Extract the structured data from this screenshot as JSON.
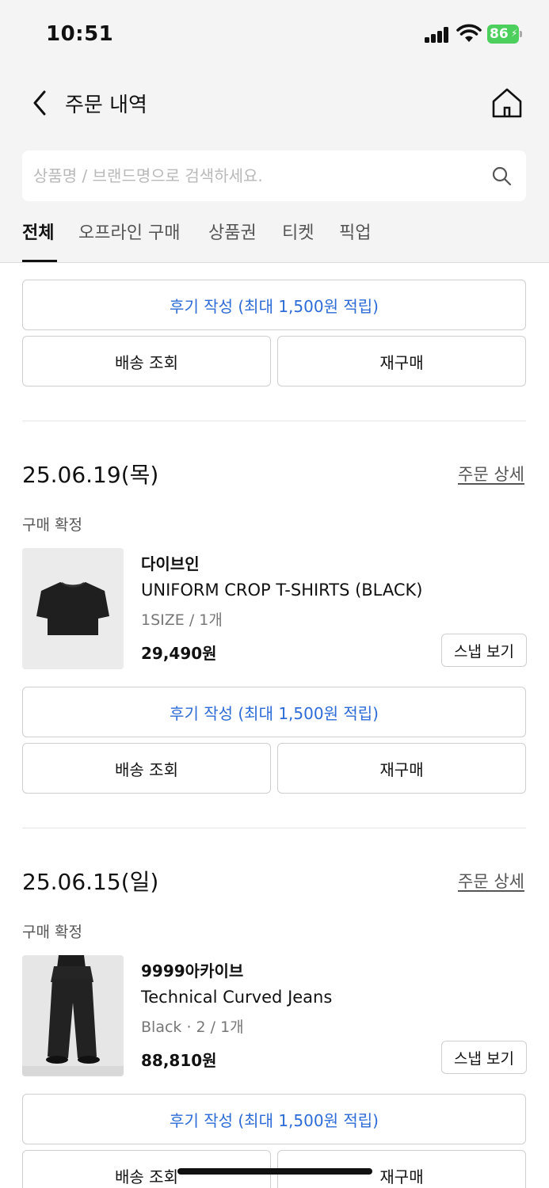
{
  "status_bar": {
    "time": "10:51",
    "battery": "86"
  },
  "header": {
    "title": "주문 내역"
  },
  "search": {
    "placeholder": "상품명 / 브랜드명으로 검색하세요."
  },
  "tabs": [
    {
      "label": "전체",
      "active": true
    },
    {
      "label": "오프라인 구매",
      "active": false
    },
    {
      "label": "상품권",
      "active": false
    },
    {
      "label": "티켓",
      "active": false
    },
    {
      "label": "픽업",
      "active": false
    }
  ],
  "buttons": {
    "review": "후기 작성 (최대 1,500원 적립)",
    "tracking": "배송 조회",
    "rebuy": "재구매",
    "snap": "스냅 보기",
    "detail": "주문 상세"
  },
  "orders": [
    {
      "date": "25.06.19(목)",
      "status": "구매 확정",
      "brand": "다이브인",
      "product": "UNIFORM CROP T-SHIRTS (BLACK)",
      "option": "1SIZE / 1개",
      "price": "29,490원"
    },
    {
      "date": "25.06.15(일)",
      "status": "구매 확정",
      "brand": "9999아카이브",
      "product": "Technical Curved Jeans",
      "option": "Black · 2 / 1개",
      "price": "88,810원"
    }
  ],
  "colors": {
    "accent_blue": "#2d6bd6",
    "battery_green": "#4ccf5c",
    "header_bg": "#f4f4f4"
  }
}
